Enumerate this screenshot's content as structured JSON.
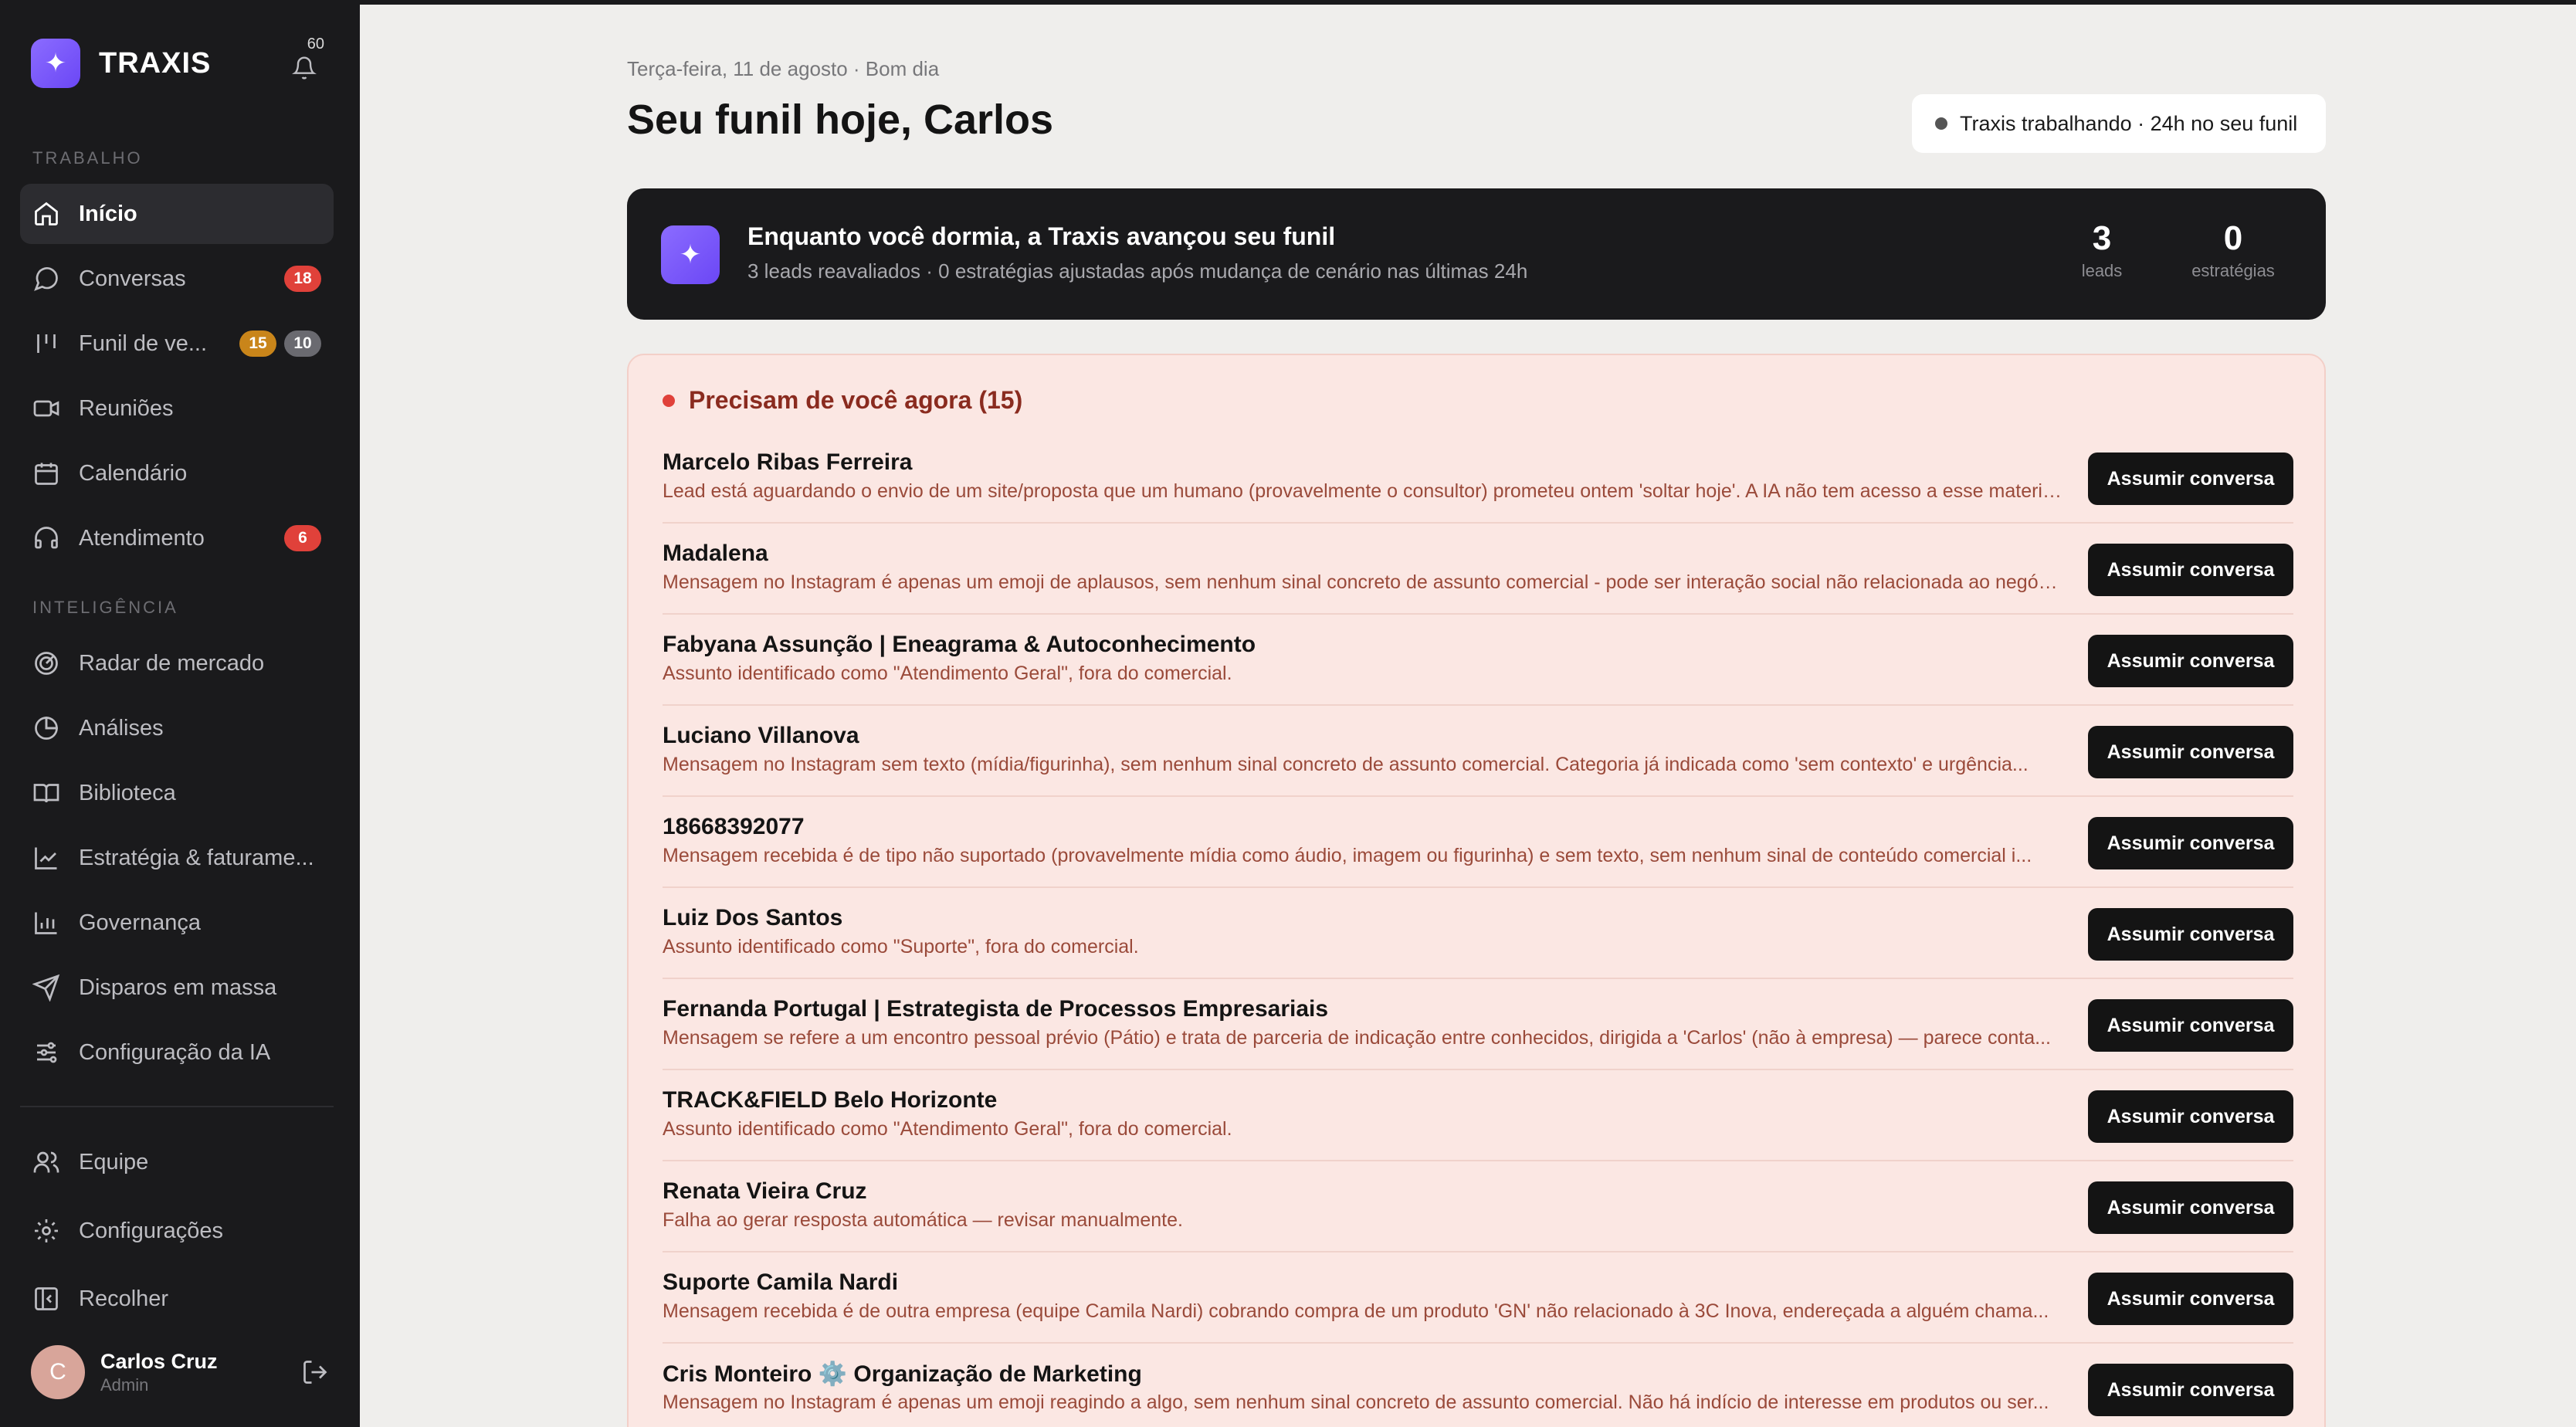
{
  "app": {
    "name": "TRAXIS",
    "notifications": "60"
  },
  "sidebar": {
    "section_work": "TRABALHO",
    "section_intel": "INTELIGÊNCIA",
    "items": [
      {
        "label": "Início",
        "icon": "home-icon"
      },
      {
        "label": "Conversas",
        "icon": "chat-icon",
        "badge": "18"
      },
      {
        "label": "Funil de ve...",
        "icon": "pipeline-icon",
        "badge": "15",
        "badge2": "10"
      },
      {
        "label": "Reuniões",
        "icon": "video-icon"
      },
      {
        "label": "Calendário",
        "icon": "calendar-icon"
      },
      {
        "label": "Atendimento",
        "icon": "headset-icon",
        "badge": "6"
      },
      {
        "label": "Radar de mercado",
        "icon": "radar-icon"
      },
      {
        "label": "Análises",
        "icon": "pie-chart-icon"
      },
      {
        "label": "Biblioteca",
        "icon": "book-icon"
      },
      {
        "label": "Estratégia & faturame...",
        "icon": "trend-icon"
      },
      {
        "label": "Governança",
        "icon": "bar-chart-icon"
      },
      {
        "label": "Disparos em massa",
        "icon": "send-icon"
      },
      {
        "label": "Configuração da IA",
        "icon": "sliders-icon"
      },
      {
        "label": "Equipe",
        "icon": "users-icon"
      },
      {
        "label": "Configurações",
        "icon": "gear-icon"
      },
      {
        "label": "Recolher",
        "icon": "collapse-icon"
      }
    ],
    "user": {
      "initial": "C",
      "name": "Carlos Cruz",
      "role": "Admin"
    }
  },
  "header": {
    "greeting": "Terça-feira, 11 de agosto · Bom dia",
    "title": "Seu funil hoje, Carlos",
    "status": "Traxis trabalhando · 24h no seu funil"
  },
  "banner": {
    "title": "Enquanto você dormia, a Traxis avançou seu funil",
    "subtitle": "3 leads reavaliados · 0 estratégias ajustadas após mudança de cenário nas últimas 24h",
    "stats": [
      {
        "value": "3",
        "label": "leads"
      },
      {
        "value": "0",
        "label": "estratégias"
      }
    ]
  },
  "urgent": {
    "title": "Precisam de você agora (15)",
    "button_label": "Assumir conversa",
    "leads": [
      {
        "name": "Marcelo Ribas Ferreira",
        "desc": "Lead está aguardando o envio de um site/proposta que um humano (provavelmente o consultor) prometeu ontem 'soltar hoje'. A IA não tem acesso a esse material..."
      },
      {
        "name": "Madalena",
        "desc": "Mensagem no Instagram é apenas um emoji de aplausos, sem nenhum sinal concreto de assunto comercial - pode ser interação social não relacionada ao negócio..."
      },
      {
        "name": "Fabyana Assunção | Eneagrama & Autoconhecimento",
        "desc": "Assunto identificado como \"Atendimento Geral\", fora do comercial."
      },
      {
        "name": "Luciano Villanova",
        "desc": "Mensagem no Instagram sem texto (mídia/figurinha), sem nenhum sinal concreto de assunto comercial. Categoria já indicada como 'sem contexto' e urgência..."
      },
      {
        "name": "18668392077",
        "desc": "Mensagem recebida é de tipo não suportado (provavelmente mídia como áudio, imagem ou figurinha) e sem texto, sem nenhum sinal de conteúdo comercial i..."
      },
      {
        "name": "Luiz Dos Santos",
        "desc": "Assunto identificado como \"Suporte\", fora do comercial."
      },
      {
        "name": "Fernanda Portugal | Estrategista de Processos Empresariais",
        "desc": "Mensagem se refere a um encontro pessoal prévio (Pátio) e trata de parceria de indicação entre conhecidos, dirigida a 'Carlos' (não à empresa) — parece conta..."
      },
      {
        "name": "TRACK&FIELD Belo Horizonte",
        "desc": "Assunto identificado como \"Atendimento Geral\", fora do comercial."
      },
      {
        "name": "Renata Vieira Cruz",
        "desc": "Falha ao gerar resposta automática — revisar manualmente."
      },
      {
        "name": "Suporte Camila Nardi",
        "desc": "Mensagem recebida é de outra empresa (equipe Camila Nardi) cobrando compra de um produto 'GN' não relacionado à 3C Inova, endereçada a alguém chama..."
      },
      {
        "name": "Cris Monteiro ⚙️ Organização de Marketing",
        "desc": "Mensagem no Instagram é apenas um emoji reagindo a algo, sem nenhum sinal concreto de assunto comercial. Não há indício de interesse em produtos ou ser..."
      }
    ]
  }
}
